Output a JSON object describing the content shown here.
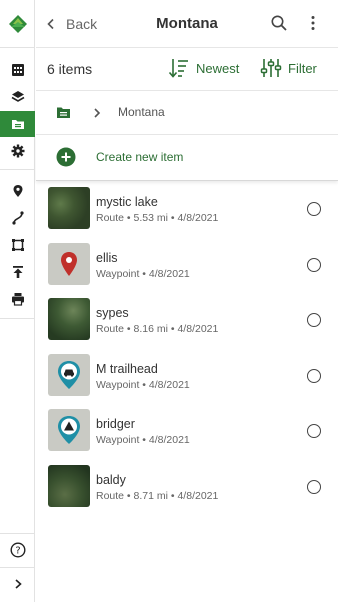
{
  "header": {
    "back_label": "Back",
    "title": "Montana"
  },
  "toolbar": {
    "count": "6 items",
    "sort_label": "Newest",
    "filter_label": "Filter"
  },
  "breadcrumb": {
    "current": "Montana"
  },
  "create": {
    "label": "Create new item"
  },
  "items": [
    {
      "name": "mystic lake",
      "meta": "Route • 5.53 mi • 4/8/2021",
      "kind": "route"
    },
    {
      "name": "ellis",
      "meta": "Waypoint • 4/8/2021",
      "kind": "waypoint",
      "icon": "location-pin-icon"
    },
    {
      "name": "sypes",
      "meta": "Route • 8.16 mi • 4/8/2021",
      "kind": "route"
    },
    {
      "name": "M trailhead",
      "meta": "Waypoint • 4/8/2021",
      "kind": "waypoint",
      "icon": "car-icon"
    },
    {
      "name": "bridger",
      "meta": "Waypoint • 4/8/2021",
      "kind": "waypoint",
      "icon": "mountain-icon"
    },
    {
      "name": "baldy",
      "meta": "Route • 8.71 mi • 4/8/2021",
      "kind": "route"
    }
  ],
  "colors": {
    "brand_green": "#2f8a3a",
    "text_green": "#2c6e34",
    "pin_red": "#c0302b",
    "pin_teal": "#1f8fa6"
  }
}
